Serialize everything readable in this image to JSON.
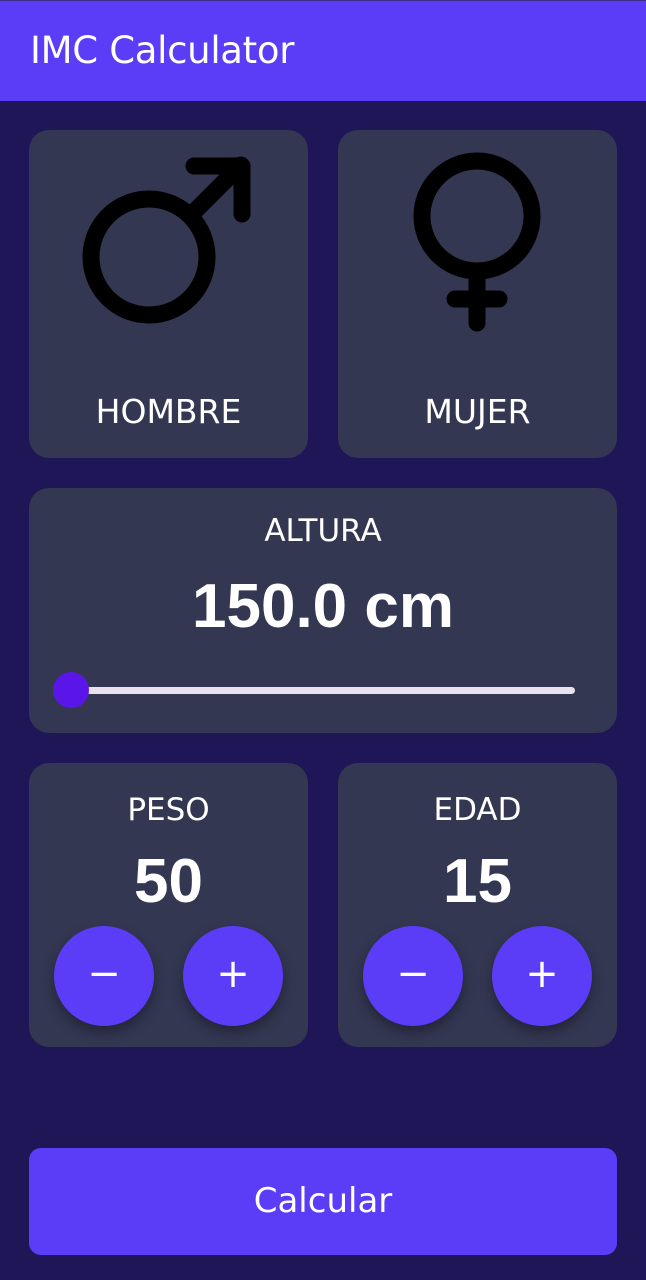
{
  "app": {
    "title": "IMC Calculator"
  },
  "colors": {
    "background": "#1f1657",
    "appbar": "#5b3df7",
    "card": "#333752",
    "accent": "#5b3df7",
    "slider_thumb": "#5a16e8",
    "text": "#ffffff"
  },
  "gender": {
    "male": {
      "label": "HOMBRE",
      "icon": "male-symbol-icon"
    },
    "female": {
      "label": "MUJER",
      "icon": "female-symbol-icon"
    }
  },
  "height": {
    "title": "ALTURA",
    "value_text": "150.0 cm",
    "slider_fraction": 0.0
  },
  "weight": {
    "title": "PESO",
    "value": "50",
    "minus_label": "−",
    "plus_label": "+"
  },
  "age": {
    "title": "EDAD",
    "value": "15",
    "minus_label": "−",
    "plus_label": "+"
  },
  "calculate": {
    "label": "Calcular"
  }
}
